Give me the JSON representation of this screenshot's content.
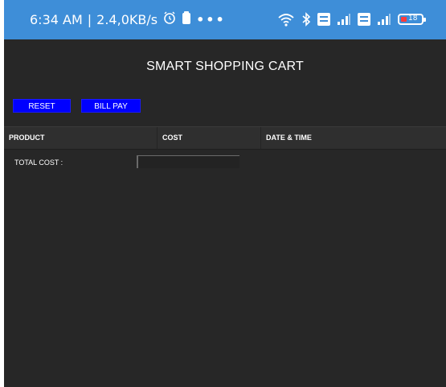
{
  "status_bar": {
    "time": "6:34 AM",
    "separator": "|",
    "network_speed": "2.4,0KB/s",
    "more": "•••",
    "battery_level": "18",
    "icons": [
      "alarm-icon",
      "storage-icon",
      "wifi-icon",
      "bluetooth-icon",
      "volte-icon",
      "signal-icon",
      "battery-icon"
    ]
  },
  "app": {
    "title": "SMART SHOPPING CART",
    "reset_label": "RESET",
    "bill_pay_label": "BILL PAY",
    "table": {
      "columns": [
        "PRODUCT",
        "COST",
        "DATE & TIME"
      ],
      "rows": []
    },
    "total_cost_label": "TOTAL COST :",
    "total_cost_value": ""
  },
  "colors": {
    "status_bar": "#3e8ed8",
    "background": "#272727",
    "button": "#0000ff",
    "text": "#ffffff",
    "battery_low": "#ff3b3b"
  }
}
